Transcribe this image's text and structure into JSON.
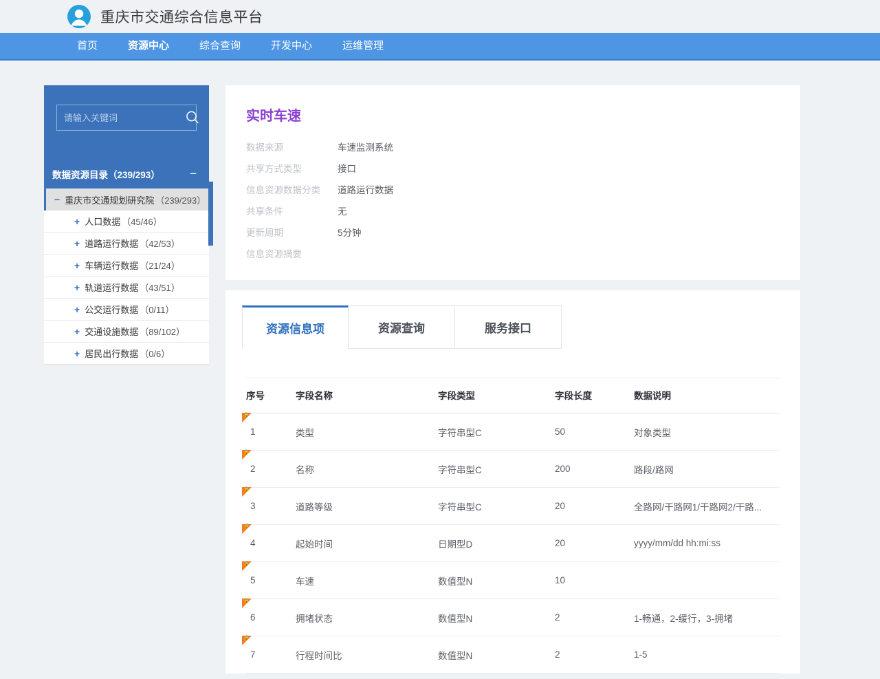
{
  "header": {
    "title": "重庆市交通综合信息平台",
    "logo_icon": "user-avatar-icon"
  },
  "nav": {
    "items": [
      {
        "label": "首页",
        "active": false
      },
      {
        "label": "资源中心",
        "active": true
      },
      {
        "label": "综合查询",
        "active": false
      },
      {
        "label": "开发中心",
        "active": false
      },
      {
        "label": "运维管理",
        "active": false
      }
    ]
  },
  "sidebar": {
    "search": {
      "placeholder": "请输入关键词",
      "value": "",
      "icon": "search-icon"
    },
    "catalog": {
      "title": "数据资源目录（239/293）",
      "collapse_symbol": "−"
    },
    "tree": {
      "root": {
        "toggle": "−",
        "label": "重庆市交通规划研究院",
        "count": "（239/293）"
      },
      "children": [
        {
          "toggle": "+",
          "label": "人口数据",
          "count": "（45/46）"
        },
        {
          "toggle": "+",
          "label": "道路运行数据",
          "count": "（42/53）"
        },
        {
          "toggle": "+",
          "label": "车辆运行数据",
          "count": "（21/24）"
        },
        {
          "toggle": "+",
          "label": "轨道运行数据",
          "count": "（43/51）"
        },
        {
          "toggle": "+",
          "label": "公交运行数据",
          "count": "（0/11）"
        },
        {
          "toggle": "+",
          "label": "交通设施数据",
          "count": "（89/102）"
        },
        {
          "toggle": "+",
          "label": "居民出行数据",
          "count": "（0/6）"
        }
      ]
    }
  },
  "detail": {
    "title": "实时车速",
    "fields": [
      {
        "label": "数据来源",
        "value": "车速监测系统"
      },
      {
        "label": "共享方式类型",
        "value": "接口"
      },
      {
        "label": "信息资源数据分类",
        "value": "道路运行数据"
      },
      {
        "label": "共享条件",
        "value": "无"
      },
      {
        "label": "更新周期",
        "value": "5分钟"
      },
      {
        "label": "信息资源摘要",
        "value": ""
      }
    ]
  },
  "tabs": [
    {
      "label": "资源信息项",
      "active": true
    },
    {
      "label": "资源查询",
      "active": false
    },
    {
      "label": "服务接口",
      "active": false
    }
  ],
  "table": {
    "columns": [
      "序号",
      "字段名称",
      "字段类型",
      "字段长度",
      "数据说明"
    ],
    "rows": [
      {
        "idx": "1",
        "name": "类型",
        "type": "字符串型C",
        "len": "50",
        "desc": "对象类型",
        "lock": "🔒"
      },
      {
        "idx": "2",
        "name": "名称",
        "type": "字符串型C",
        "len": "200",
        "desc": "路段/路网",
        "lock": "🔒"
      },
      {
        "idx": "3",
        "name": "道路等级",
        "type": "字符串型C",
        "len": "20",
        "desc": "全路网/干路网1/干路网2/干路...",
        "lock": "🔒"
      },
      {
        "idx": "4",
        "name": "起始时间",
        "type": "日期型D",
        "len": "20",
        "desc": "yyyy/mm/dd hh:mi:ss",
        "lock": "🔒"
      },
      {
        "idx": "5",
        "name": "车速",
        "type": "数值型N",
        "len": "10",
        "desc": "",
        "lock": "🔒"
      },
      {
        "idx": "6",
        "name": "拥堵状态",
        "type": "数值型N",
        "len": "2",
        "desc": "1-畅通，2-缓行，3-拥堵",
        "lock": "🔒"
      },
      {
        "idx": "7",
        "name": "行程时间比",
        "type": "数值型N",
        "len": "2",
        "desc": "1-5",
        "lock": "🔒"
      }
    ]
  },
  "colors": {
    "nav_blue": "#4e95e4",
    "sidebar_blue": "#3b72ba",
    "accent_blue": "#2f6fbf",
    "title_purple": "#8a3fd1",
    "lock_orange": "#f47b20",
    "page_bg": "#eff2f4"
  }
}
